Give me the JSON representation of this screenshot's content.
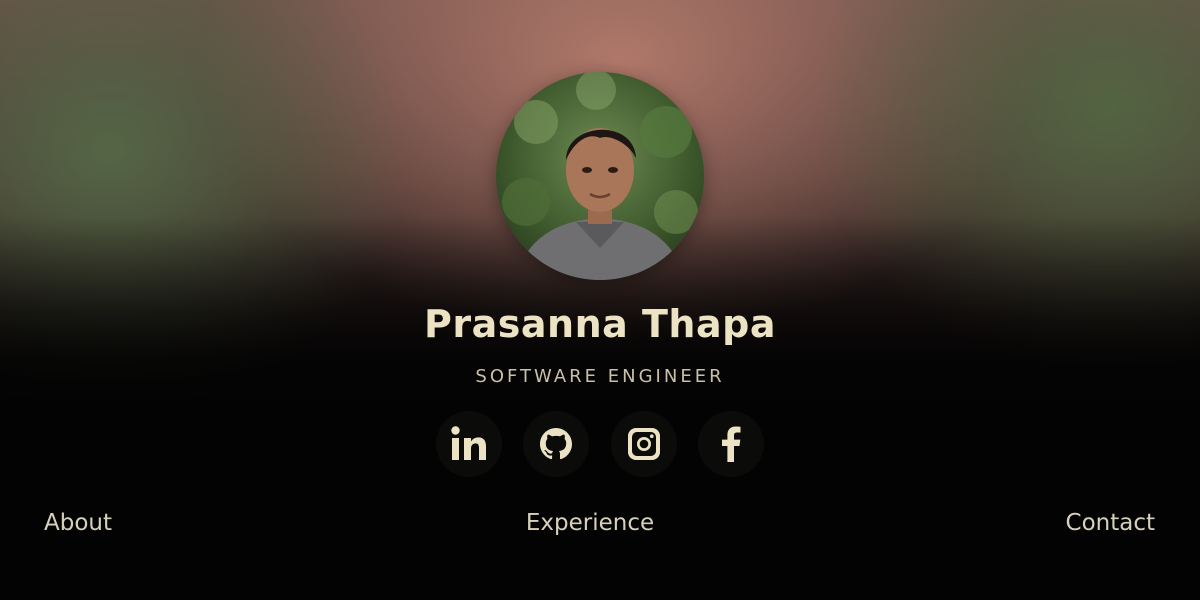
{
  "profile": {
    "name": "Prasanna Thapa",
    "role": "SOFTWARE ENGINEER",
    "avatar_icon": "profile-photo"
  },
  "socials": [
    {
      "icon": "linkedin-icon"
    },
    {
      "icon": "github-icon"
    },
    {
      "icon": "instagram-icon"
    },
    {
      "icon": "facebook-icon"
    }
  ],
  "nav": {
    "about": "About",
    "experience": "Experience",
    "contact": "Contact"
  },
  "colors": {
    "text_primary": "#ece3c4",
    "text_secondary": "#c9c0a6",
    "icon": "#ece3c4",
    "background": "#030303"
  }
}
